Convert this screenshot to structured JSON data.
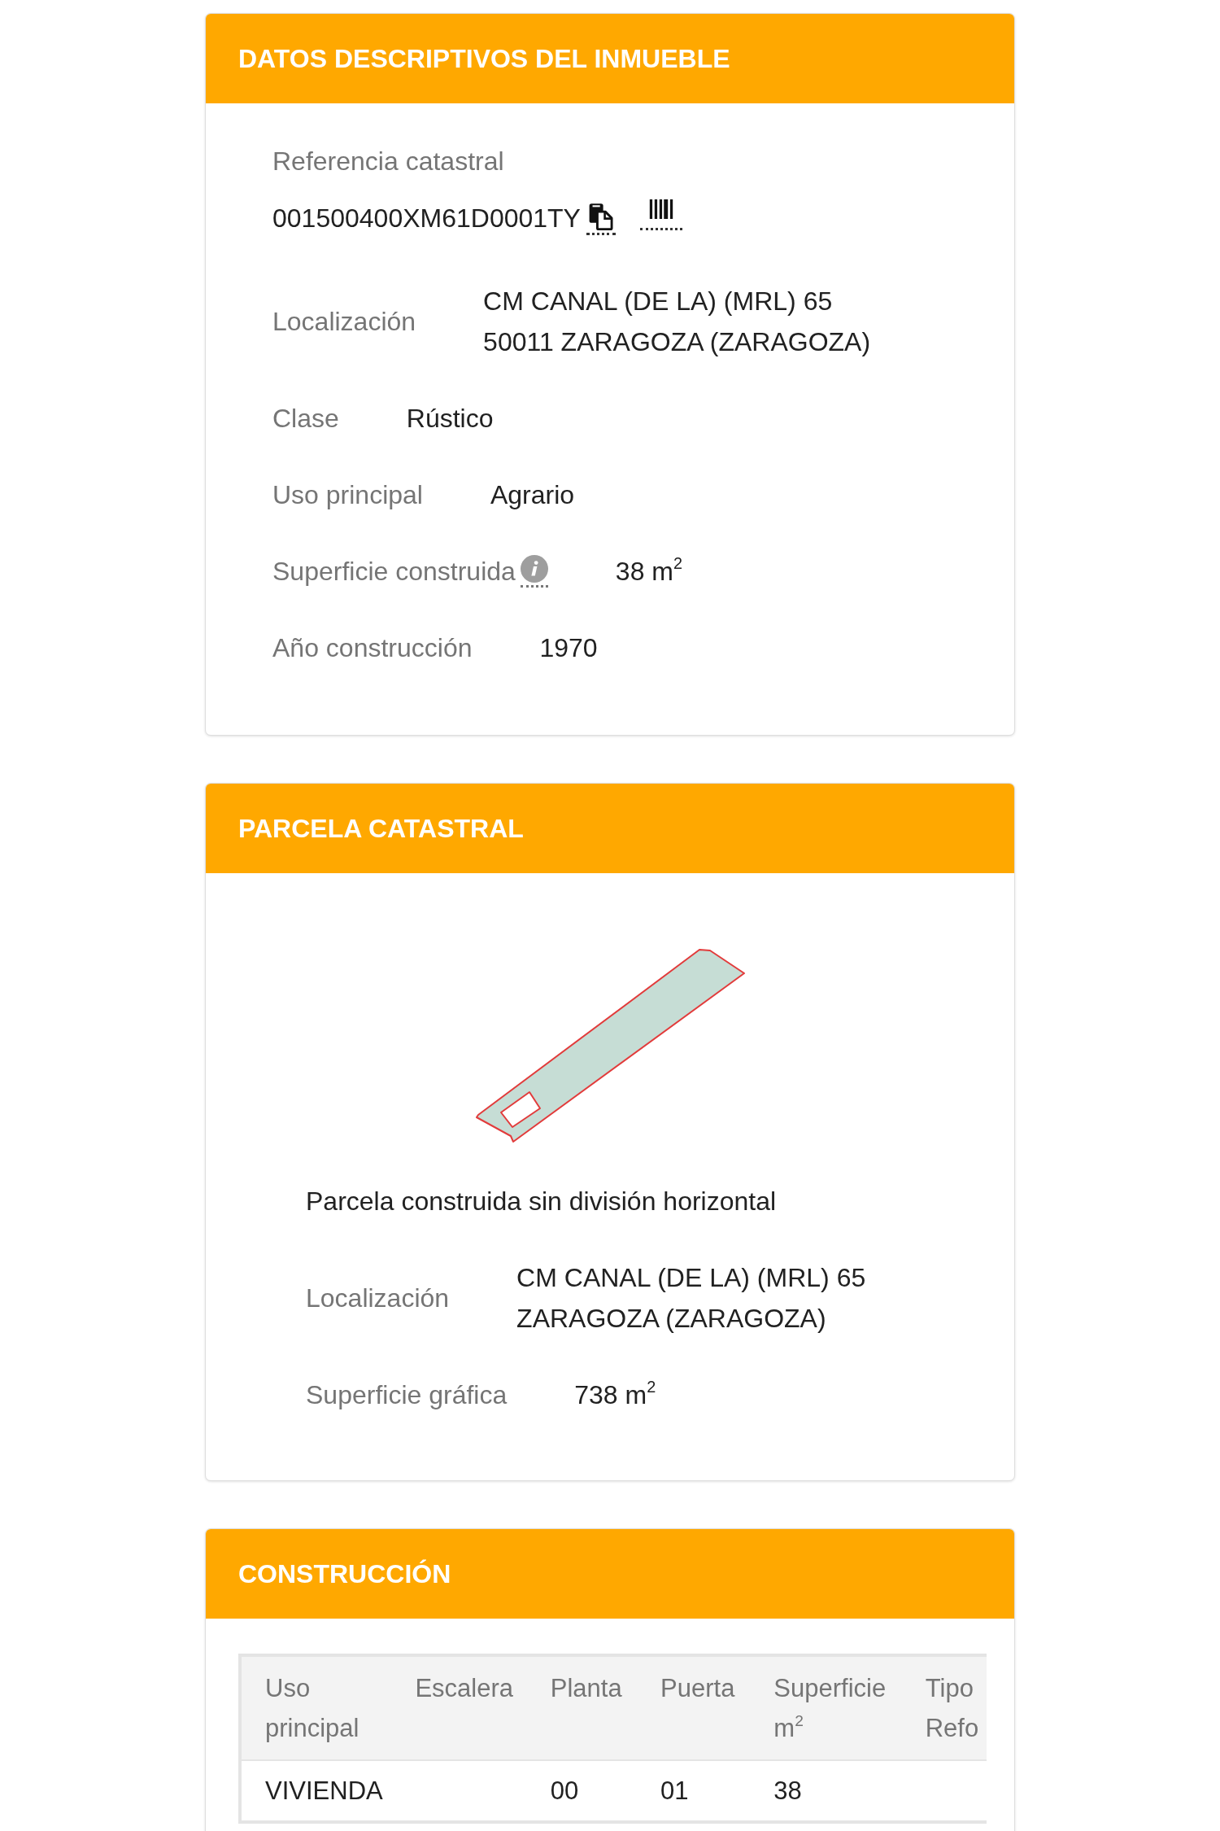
{
  "sections": [
    {
      "kind": "details",
      "title": "DATOS DESCRIPTIVOS DEL INMUEBLE",
      "reference": {
        "label": "Referencia catastral",
        "value": "001500400XM61D0001TY"
      },
      "fields": [
        {
          "kind": "text",
          "label": "Localización",
          "value": "CM CANAL (DE LA) (MRL) 65\n50011 ZARAGOZA (ZARAGOZA)"
        },
        {
          "kind": "text",
          "label": "Clase",
          "value": "Rústico"
        },
        {
          "kind": "text",
          "label": "Uso principal",
          "value": "Agrario"
        },
        {
          "kind": "info",
          "label": "Superficie construida",
          "value": "38 m$^{2}$"
        },
        {
          "kind": "text",
          "label": "Año construcción",
          "value": "1970"
        }
      ]
    },
    {
      "kind": "parcel",
      "title": "PARCELA CATASTRAL",
      "description": "Parcela construida sin división horizontal",
      "fields": [
        {
          "kind": "text",
          "label": "Localización",
          "value": "CM CANAL (DE LA) (MRL) 65\nZARAGOZA (ZARAGOZA)"
        },
        {
          "kind": "text",
          "label": "Superficie gráfica",
          "value": "738 m$^{2}$"
        }
      ]
    },
    {
      "kind": "table",
      "title": "CONSTRUCCIÓN",
      "table": {
        "columns": [
          "Uso principal",
          "Escalera",
          "Planta",
          "Puerta",
          "Superficie m$^{2}$",
          "Tipo Refo"
        ],
        "rows": [
          [
            "VIVIENDA",
            null,
            "00",
            "01",
            "38",
            null
          ]
        ]
      }
    }
  ]
}
